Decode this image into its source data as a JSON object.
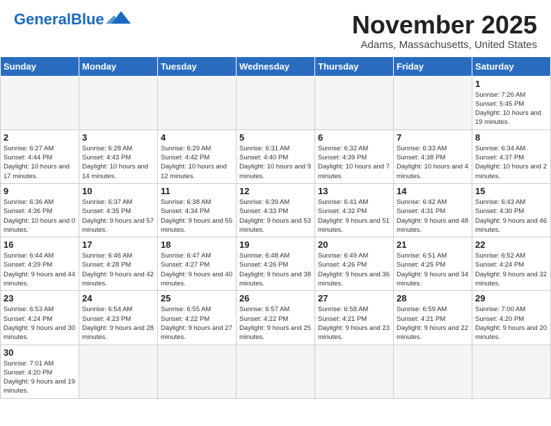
{
  "header": {
    "logo_general": "General",
    "logo_blue": "Blue",
    "month_title": "November 2025",
    "location": "Adams, Massachusetts, United States"
  },
  "weekdays": [
    "Sunday",
    "Monday",
    "Tuesday",
    "Wednesday",
    "Thursday",
    "Friday",
    "Saturday"
  ],
  "weeks": [
    [
      {
        "day": "",
        "info": ""
      },
      {
        "day": "",
        "info": ""
      },
      {
        "day": "",
        "info": ""
      },
      {
        "day": "",
        "info": ""
      },
      {
        "day": "",
        "info": ""
      },
      {
        "day": "",
        "info": ""
      },
      {
        "day": "1",
        "info": "Sunrise: 7:26 AM\nSunset: 5:45 PM\nDaylight: 10 hours and 19 minutes."
      }
    ],
    [
      {
        "day": "2",
        "info": "Sunrise: 6:27 AM\nSunset: 4:44 PM\nDaylight: 10 hours and 17 minutes."
      },
      {
        "day": "3",
        "info": "Sunrise: 6:28 AM\nSunset: 4:43 PM\nDaylight: 10 hours and 14 minutes."
      },
      {
        "day": "4",
        "info": "Sunrise: 6:29 AM\nSunset: 4:42 PM\nDaylight: 10 hours and 12 minutes."
      },
      {
        "day": "5",
        "info": "Sunrise: 6:31 AM\nSunset: 4:40 PM\nDaylight: 10 hours and 9 minutes."
      },
      {
        "day": "6",
        "info": "Sunrise: 6:32 AM\nSunset: 4:39 PM\nDaylight: 10 hours and 7 minutes."
      },
      {
        "day": "7",
        "info": "Sunrise: 6:33 AM\nSunset: 4:38 PM\nDaylight: 10 hours and 4 minutes."
      },
      {
        "day": "8",
        "info": "Sunrise: 6:34 AM\nSunset: 4:37 PM\nDaylight: 10 hours and 2 minutes."
      }
    ],
    [
      {
        "day": "9",
        "info": "Sunrise: 6:36 AM\nSunset: 4:36 PM\nDaylight: 10 hours and 0 minutes."
      },
      {
        "day": "10",
        "info": "Sunrise: 6:37 AM\nSunset: 4:35 PM\nDaylight: 9 hours and 57 minutes."
      },
      {
        "day": "11",
        "info": "Sunrise: 6:38 AM\nSunset: 4:34 PM\nDaylight: 9 hours and 55 minutes."
      },
      {
        "day": "12",
        "info": "Sunrise: 6:39 AM\nSunset: 4:33 PM\nDaylight: 9 hours and 53 minutes."
      },
      {
        "day": "13",
        "info": "Sunrise: 6:41 AM\nSunset: 4:32 PM\nDaylight: 9 hours and 51 minutes."
      },
      {
        "day": "14",
        "info": "Sunrise: 6:42 AM\nSunset: 4:31 PM\nDaylight: 9 hours and 48 minutes."
      },
      {
        "day": "15",
        "info": "Sunrise: 6:43 AM\nSunset: 4:30 PM\nDaylight: 9 hours and 46 minutes."
      }
    ],
    [
      {
        "day": "16",
        "info": "Sunrise: 6:44 AM\nSunset: 4:29 PM\nDaylight: 9 hours and 44 minutes."
      },
      {
        "day": "17",
        "info": "Sunrise: 6:46 AM\nSunset: 4:28 PM\nDaylight: 9 hours and 42 minutes."
      },
      {
        "day": "18",
        "info": "Sunrise: 6:47 AM\nSunset: 4:27 PM\nDaylight: 9 hours and 40 minutes."
      },
      {
        "day": "19",
        "info": "Sunrise: 6:48 AM\nSunset: 4:26 PM\nDaylight: 9 hours and 38 minutes."
      },
      {
        "day": "20",
        "info": "Sunrise: 6:49 AM\nSunset: 4:26 PM\nDaylight: 9 hours and 36 minutes."
      },
      {
        "day": "21",
        "info": "Sunrise: 6:51 AM\nSunset: 4:25 PM\nDaylight: 9 hours and 34 minutes."
      },
      {
        "day": "22",
        "info": "Sunrise: 6:52 AM\nSunset: 4:24 PM\nDaylight: 9 hours and 32 minutes."
      }
    ],
    [
      {
        "day": "23",
        "info": "Sunrise: 6:53 AM\nSunset: 4:24 PM\nDaylight: 9 hours and 30 minutes."
      },
      {
        "day": "24",
        "info": "Sunrise: 6:54 AM\nSunset: 4:23 PM\nDaylight: 9 hours and 28 minutes."
      },
      {
        "day": "25",
        "info": "Sunrise: 6:55 AM\nSunset: 4:22 PM\nDaylight: 9 hours and 27 minutes."
      },
      {
        "day": "26",
        "info": "Sunrise: 6:57 AM\nSunset: 4:22 PM\nDaylight: 9 hours and 25 minutes."
      },
      {
        "day": "27",
        "info": "Sunrise: 6:58 AM\nSunset: 4:21 PM\nDaylight: 9 hours and 23 minutes."
      },
      {
        "day": "28",
        "info": "Sunrise: 6:59 AM\nSunset: 4:21 PM\nDaylight: 9 hours and 22 minutes."
      },
      {
        "day": "29",
        "info": "Sunrise: 7:00 AM\nSunset: 4:20 PM\nDaylight: 9 hours and 20 minutes."
      }
    ],
    [
      {
        "day": "30",
        "info": "Sunrise: 7:01 AM\nSunset: 4:20 PM\nDaylight: 9 hours and 19 minutes."
      },
      {
        "day": "",
        "info": ""
      },
      {
        "day": "",
        "info": ""
      },
      {
        "day": "",
        "info": ""
      },
      {
        "day": "",
        "info": ""
      },
      {
        "day": "",
        "info": ""
      },
      {
        "day": "",
        "info": ""
      }
    ]
  ]
}
